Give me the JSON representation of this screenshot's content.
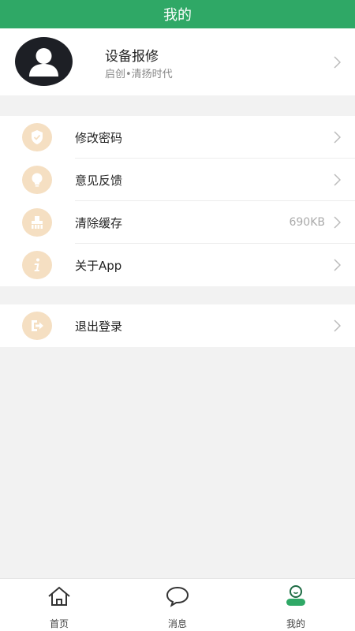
{
  "header": {
    "title": "我的"
  },
  "profile": {
    "name": "设备报修",
    "subtitle": "启创•清扬时代",
    "avatar_icon": "user-avatar-icon"
  },
  "settings_group": [
    {
      "label": "修改密码",
      "icon": "shield-icon"
    },
    {
      "label": "意见反馈",
      "icon": "lightbulb-icon"
    },
    {
      "label": "清除缓存",
      "icon": "broom-icon",
      "value": "690KB"
    },
    {
      "label": "关于App",
      "icon": "info-icon"
    }
  ],
  "logout": {
    "label": "退出登录",
    "icon": "logout-icon"
  },
  "tabbar": [
    {
      "label": "首页",
      "icon": "home-icon"
    },
    {
      "label": "消息",
      "icon": "message-icon"
    },
    {
      "label": "我的",
      "icon": "profile-icon",
      "active": true
    }
  ],
  "colors": {
    "header": "#2fa866",
    "icon_bg": "#f5dfc2",
    "icon_fg": "#ffffff",
    "active_tab": "#2fa866"
  }
}
